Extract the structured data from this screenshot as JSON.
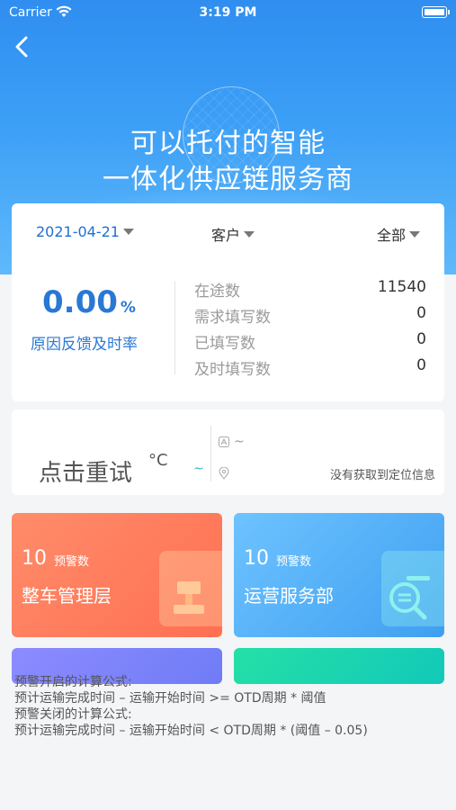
{
  "status_bar": {
    "carrier": "Carrier",
    "time": "3:19 PM"
  },
  "hero": {
    "title_line1": "可以托付的智能",
    "title_line2": "一体化供应链服务商"
  },
  "filters": {
    "date": "2021-04-21",
    "customer": "客户",
    "scope": "全部"
  },
  "summary": {
    "rate_value": "0.00",
    "rate_unit": "%",
    "rate_label": "原因反馈及时率",
    "stats": [
      {
        "label": "在途数",
        "value": "11540"
      },
      {
        "label": "需求填写数",
        "value": "0"
      },
      {
        "label": "已填写数",
        "value": "0"
      },
      {
        "label": "及时填写数",
        "value": "0"
      }
    ]
  },
  "weather": {
    "retry_text": "点击重试",
    "degree": "°C",
    "tilde_left": "~",
    "ac_tilde": "~",
    "location_text": "没有获取到定位信息"
  },
  "tiles": [
    {
      "count": "10",
      "tag": "预警数",
      "name": "整车管理层"
    },
    {
      "count": "10",
      "tag": "预警数",
      "name": "运营服务部"
    }
  ],
  "formula": {
    "line1": "预警开启的计算公式:",
    "line2": "预计运输完成时间 – 运输开始时间 >= OTD周期 * 阈值",
    "line3": "预警关闭的计算公式:",
    "line4": "预计运输完成时间 – 运输开始时间 < OTD周期 * (阈值 – 0.05)"
  },
  "colors": {
    "accent": "#2a78d4",
    "tile_orange": "#ff7a5c",
    "tile_blue": "#4fa9f5",
    "tile_purple": "#7f84fa",
    "tile_teal": "#1fd6ad"
  },
  "icons": [
    "wifi-icon",
    "battery-icon",
    "back-icon",
    "caret-down-icon",
    "ac-icon",
    "location-pin-icon",
    "person-icon",
    "search-doc-icon"
  ]
}
